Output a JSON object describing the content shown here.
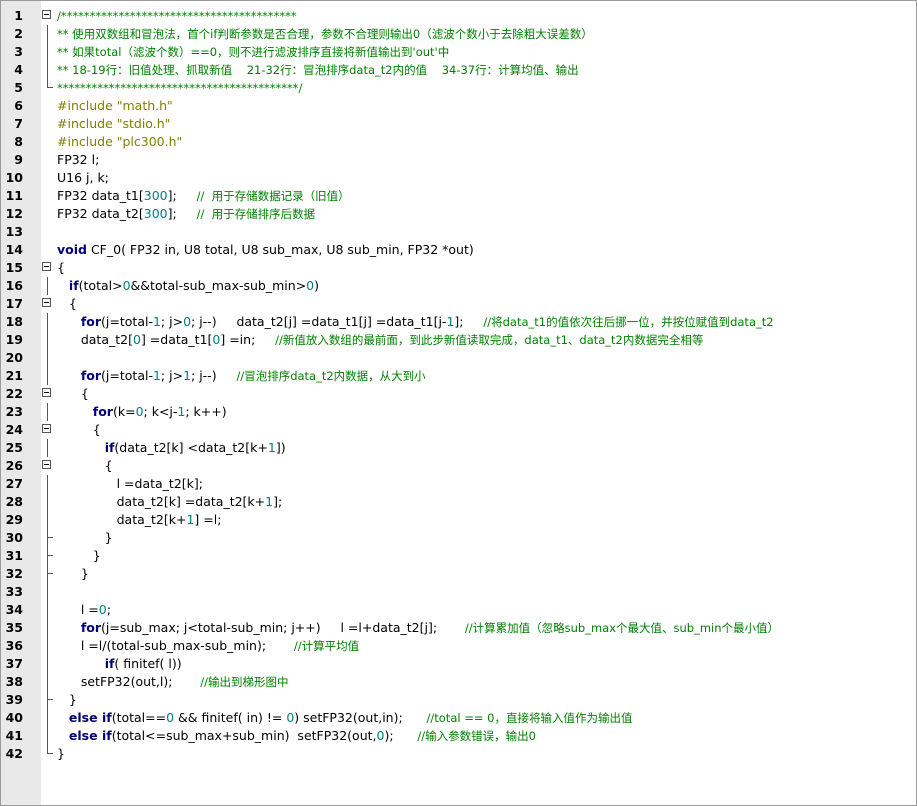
{
  "lines": [
    {
      "n": "1",
      "parts": [
        [
          "cm",
          "/*****************************************"
        ]
      ]
    },
    {
      "n": "2",
      "parts": [
        [
          "cm",
          "** 使用双数组和冒泡法，首个if判断参数是否合理，参数不合理则输出0（滤波个数小于去除粗大误差数）"
        ]
      ]
    },
    {
      "n": "3",
      "parts": [
        [
          "cm",
          "** 如果total（滤波个数）==0，则不进行滤波排序直接将新值输出到'out'中"
        ]
      ]
    },
    {
      "n": "4",
      "parts": [
        [
          "cm",
          "** 18-19行：旧值处理、抓取新值    21-32行：冒泡排序data_t2内的值    34-37行：计算均值、输出"
        ]
      ]
    },
    {
      "n": "5",
      "parts": [
        [
          "cm",
          "******************************************/"
        ]
      ]
    },
    {
      "n": "6",
      "parts": [
        [
          "pp",
          "#include \"math.h\""
        ]
      ]
    },
    {
      "n": "7",
      "parts": [
        [
          "pp",
          "#include \"stdio.h\""
        ]
      ]
    },
    {
      "n": "8",
      "parts": [
        [
          "pp",
          "#include \"plc300.h\""
        ]
      ]
    },
    {
      "n": "9",
      "parts": [
        [
          "t",
          "FP32 l;"
        ]
      ]
    },
    {
      "n": "10",
      "parts": [
        [
          "t",
          "U16 j, k;"
        ]
      ]
    },
    {
      "n": "11",
      "parts": [
        [
          "t",
          "FP32 data_t1["
        ],
        [
          "num",
          "300"
        ],
        [
          "t",
          "];     "
        ],
        [
          "cm",
          "//  用于存储数据记录（旧值）"
        ]
      ]
    },
    {
      "n": "12",
      "parts": [
        [
          "t",
          "FP32 data_t2["
        ],
        [
          "num",
          "300"
        ],
        [
          "t",
          "];     "
        ],
        [
          "cm",
          "//  用于存储排序后数据"
        ]
      ]
    },
    {
      "n": "13",
      "parts": []
    },
    {
      "n": "14",
      "parts": [
        [
          "k",
          "void"
        ],
        [
          "t",
          " CF_0( FP32 in, U8 total, U8 sub_max, U8 sub_min, FP32 *out)"
        ]
      ]
    },
    {
      "n": "15",
      "parts": [
        [
          "t",
          "{"
        ]
      ]
    },
    {
      "n": "16",
      "parts": [
        [
          "t",
          "   "
        ],
        [
          "k",
          "if"
        ],
        [
          "t",
          "(total>"
        ],
        [
          "num",
          "0"
        ],
        [
          "t",
          "&&total-sub_max-sub_min>"
        ],
        [
          "num",
          "0"
        ],
        [
          "t",
          ")"
        ]
      ]
    },
    {
      "n": "17",
      "parts": [
        [
          "t",
          "   {"
        ]
      ]
    },
    {
      "n": "18",
      "parts": [
        [
          "t",
          "      "
        ],
        [
          "k",
          "for"
        ],
        [
          "t",
          "(j=total-"
        ],
        [
          "num",
          "1"
        ],
        [
          "t",
          "; j>"
        ],
        [
          "num",
          "0"
        ],
        [
          "t",
          "; j--)     data_t2[j] =data_t1[j] =data_t1[j-"
        ],
        [
          "num",
          "1"
        ],
        [
          "t",
          "];     "
        ],
        [
          "cm",
          "//将data_t1的值依次往后挪一位，并按位赋值到data_t2"
        ]
      ]
    },
    {
      "n": "19",
      "parts": [
        [
          "t",
          "      data_t2["
        ],
        [
          "num",
          "0"
        ],
        [
          "t",
          "] =data_t1["
        ],
        [
          "num",
          "0"
        ],
        [
          "t",
          "] =in;     "
        ],
        [
          "cm",
          "//新值放入数组的最前面，到此步新值读取完成，data_t1、data_t2内数据完全相等"
        ]
      ]
    },
    {
      "n": "20",
      "parts": []
    },
    {
      "n": "21",
      "parts": [
        [
          "t",
          "      "
        ],
        [
          "k",
          "for"
        ],
        [
          "t",
          "(j=total-"
        ],
        [
          "num",
          "1"
        ],
        [
          "t",
          "; j>"
        ],
        [
          "num",
          "1"
        ],
        [
          "t",
          "; j--)     "
        ],
        [
          "cm",
          "//冒泡排序data_t2内数据，从大到小"
        ]
      ]
    },
    {
      "n": "22",
      "parts": [
        [
          "t",
          "      {"
        ]
      ]
    },
    {
      "n": "23",
      "parts": [
        [
          "t",
          "         "
        ],
        [
          "k",
          "for"
        ],
        [
          "t",
          "(k="
        ],
        [
          "num",
          "0"
        ],
        [
          "t",
          "; k<j-"
        ],
        [
          "num",
          "1"
        ],
        [
          "t",
          "; k++)"
        ]
      ]
    },
    {
      "n": "24",
      "parts": [
        [
          "t",
          "         {"
        ]
      ]
    },
    {
      "n": "25",
      "parts": [
        [
          "t",
          "            "
        ],
        [
          "k",
          "if"
        ],
        [
          "t",
          "(data_t2[k] <data_t2[k+"
        ],
        [
          "num",
          "1"
        ],
        [
          "t",
          "])"
        ]
      ]
    },
    {
      "n": "26",
      "parts": [
        [
          "t",
          "            {"
        ]
      ]
    },
    {
      "n": "27",
      "parts": [
        [
          "t",
          "               l =data_t2[k];"
        ]
      ]
    },
    {
      "n": "28",
      "parts": [
        [
          "t",
          "               data_t2[k] =data_t2[k+"
        ],
        [
          "num",
          "1"
        ],
        [
          "t",
          "];"
        ]
      ]
    },
    {
      "n": "29",
      "parts": [
        [
          "t",
          "               data_t2[k+"
        ],
        [
          "num",
          "1"
        ],
        [
          "t",
          "] =l;"
        ]
      ]
    },
    {
      "n": "30",
      "parts": [
        [
          "t",
          "            }"
        ]
      ]
    },
    {
      "n": "31",
      "parts": [
        [
          "t",
          "         }"
        ]
      ]
    },
    {
      "n": "32",
      "parts": [
        [
          "t",
          "      }"
        ]
      ]
    },
    {
      "n": "33",
      "parts": []
    },
    {
      "n": "34",
      "parts": [
        [
          "t",
          "      l ="
        ],
        [
          "num",
          "0"
        ],
        [
          "t",
          ";"
        ]
      ]
    },
    {
      "n": "35",
      "parts": [
        [
          "t",
          "      "
        ],
        [
          "k",
          "for"
        ],
        [
          "t",
          "(j=sub_max; j<total-sub_min; j++)     l =l+data_t2[j];       "
        ],
        [
          "cm",
          "//计算累加值（忽略sub_max个最大值、sub_min个最小值）"
        ]
      ]
    },
    {
      "n": "36",
      "parts": [
        [
          "t",
          "      l =l/(total-sub_max-sub_min);       "
        ],
        [
          "cm",
          "//计算平均值"
        ]
      ]
    },
    {
      "n": "37",
      "parts": [
        [
          "t",
          "            "
        ],
        [
          "k",
          "if"
        ],
        [
          "t",
          "( finitef( l))"
        ]
      ]
    },
    {
      "n": "38",
      "parts": [
        [
          "t",
          "      setFP32(out,l);       "
        ],
        [
          "cm",
          "//输出到梯形图中"
        ]
      ]
    },
    {
      "n": "39",
      "parts": [
        [
          "t",
          "   }"
        ]
      ]
    },
    {
      "n": "40",
      "parts": [
        [
          "t",
          "   "
        ],
        [
          "k",
          "else if"
        ],
        [
          "t",
          "(total=="
        ],
        [
          "num",
          "0"
        ],
        [
          "t",
          " && finitef( in) != "
        ],
        [
          "num",
          "0"
        ],
        [
          "t",
          ") setFP32(out,in);      "
        ],
        [
          "cm",
          "//total == 0，直接将输入值作为输出值"
        ]
      ]
    },
    {
      "n": "41",
      "parts": [
        [
          "t",
          "   "
        ],
        [
          "k",
          "else if"
        ],
        [
          "t",
          "(total<=sub_max+sub_min)  setFP32(out,"
        ],
        [
          "num",
          "0"
        ],
        [
          "t",
          ");      "
        ],
        [
          "cm",
          "//输入参数错误，输出0"
        ]
      ]
    },
    {
      "n": "42",
      "parts": [
        [
          "t",
          "}"
        ]
      ]
    }
  ]
}
